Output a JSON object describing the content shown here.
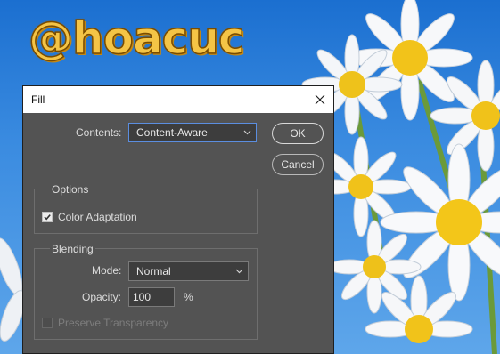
{
  "background": {
    "watermark": "@hoacuc"
  },
  "dialog": {
    "title": "Fill",
    "close_icon": "close-icon",
    "contents": {
      "label": "Contents:",
      "value": "Content-Aware"
    },
    "ok_label": "OK",
    "cancel_label": "Cancel",
    "options": {
      "title": "Options",
      "color_adaptation": {
        "label": "Color Adaptation",
        "checked": true
      }
    },
    "blending": {
      "title": "Blending",
      "mode": {
        "label": "Mode:",
        "value": "Normal"
      },
      "opacity": {
        "label": "Opacity:",
        "value": "100",
        "unit": "%"
      },
      "preserve_transparency": {
        "label": "Preserve Transparency",
        "checked": false,
        "enabled": false
      }
    }
  },
  "colors": {
    "dialog_bg": "#535353",
    "focus_accent": "#5b8ee0",
    "sky": "#2f80dc",
    "watermark": "#f4c446"
  }
}
